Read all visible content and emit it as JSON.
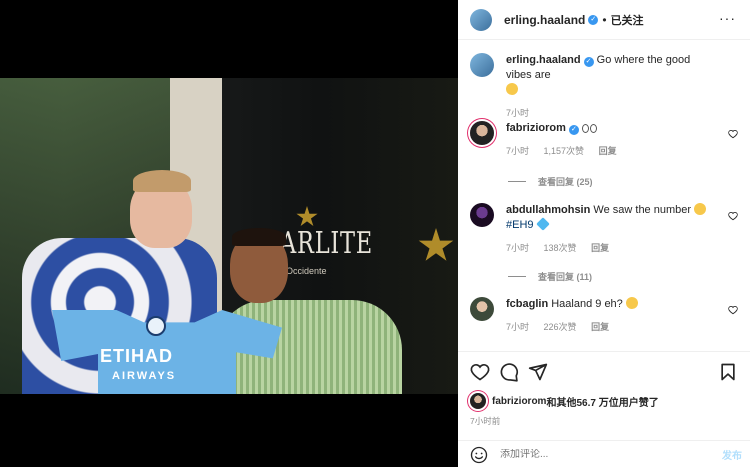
{
  "header": {
    "username": "erling.haaland",
    "verified_mark": "✓",
    "separator": "•",
    "follow_label": "已关注",
    "more": "···"
  },
  "photo": {
    "venue_text": "ARLITE",
    "venue_sub": "Occidente",
    "jersey_text": "ETIHAD",
    "jersey_sub": "AIRWAYS"
  },
  "caption": {
    "username": "erling.haaland",
    "text": "Go where the good vibes are",
    "time": "7小时"
  },
  "comments": [
    {
      "username": "fabriziorom",
      "text": "",
      "time": "7小时",
      "likes": "1,157次赞",
      "reply": "回复",
      "view_replies": "查看回复 (25)"
    },
    {
      "username": "abdullahmohsin",
      "text": "We saw the number",
      "hashtag": "#EH9",
      "time": "7小时",
      "likes": "138次赞",
      "reply": "回复",
      "view_replies": "查看回复 (11)"
    },
    {
      "username": "fcbaglin",
      "text": "Haaland 9 eh?",
      "time": "7小时",
      "likes": "226次赞",
      "reply": "回复"
    }
  ],
  "likes_line": {
    "user": "fabriziorom",
    "rest": "和其他56.7 万位用户赞了"
  },
  "post_time": "7小时前",
  "add_comment": {
    "placeholder": "添加评论...",
    "post_label": "发布"
  },
  "icons": {
    "like": "heart-icon",
    "comment": "comment-icon",
    "share": "paper-plane-icon",
    "save": "bookmark-icon",
    "emoji": "smiley-icon"
  }
}
